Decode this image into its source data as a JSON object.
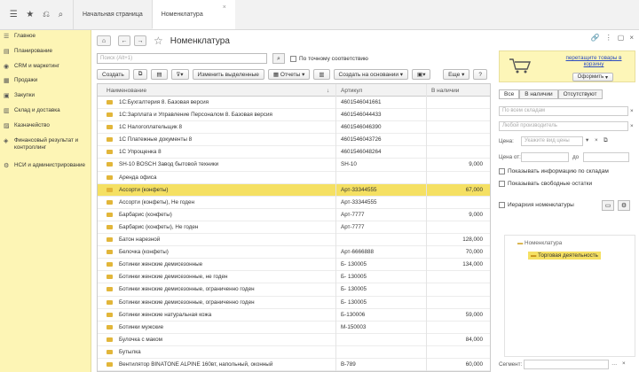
{
  "tabs": [
    {
      "label": "Начальная страница"
    },
    {
      "label": "Номенклатура"
    }
  ],
  "sidebar": {
    "items": [
      {
        "label": "Главное",
        "icon": "menu-icon"
      },
      {
        "label": "Планирование",
        "icon": "planning-icon"
      },
      {
        "label": "CRM и маркетинг",
        "icon": "crm-icon"
      },
      {
        "label": "Продажи",
        "icon": "sales-icon"
      },
      {
        "label": "Закупки",
        "icon": "purchases-icon"
      },
      {
        "label": "Склад и доставка",
        "icon": "warehouse-icon"
      },
      {
        "label": "Казначейство",
        "icon": "treasury-icon"
      },
      {
        "label": "Финансовый результат и контроллинг",
        "icon": "finance-icon"
      },
      {
        "label": "НСИ и администрирование",
        "icon": "gear-icon"
      }
    ]
  },
  "window": {
    "title": "Номенклатура",
    "search_placeholder": "Поиск (Alt+1)",
    "exact_match_label": "По точному соответствию"
  },
  "toolbar": {
    "create": "Создать",
    "change_selected": "Изменить выделенные",
    "reports": "Отчеты",
    "create_based": "Создать на основании",
    "more": "Еще"
  },
  "table": {
    "columns": [
      "Наименование",
      "Артикул",
      "В наличии"
    ],
    "rows": [
      {
        "name": "1С:Бухгалтерия 8. Базовая версия",
        "article": "4601546041661",
        "qty": ""
      },
      {
        "name": "1С:Зарплата и Управление Персоналом 8. Базовая версия",
        "article": "4601546044433",
        "qty": ""
      },
      {
        "name": "1С Налогоплательщик 8",
        "article": "4601546046390",
        "qty": ""
      },
      {
        "name": "1С Платежные документы 8",
        "article": "4601546043726",
        "qty": ""
      },
      {
        "name": "1С Упрощенка 8",
        "article": "4601546048264",
        "qty": ""
      },
      {
        "name": "SH-10 BOSCH Завод бытовой техники",
        "article": "SH-10",
        "qty": "9,000"
      },
      {
        "name": "Аренда офиса",
        "article": "",
        "qty": ""
      },
      {
        "name": "Ассорти (конфеты)",
        "article": "Арт-33344555",
        "qty": "67,000"
      },
      {
        "name": "Ассорти (конфеты), Не годен",
        "article": "Арт-33344555",
        "qty": ""
      },
      {
        "name": "Барбарис (конфеты)",
        "article": "Арт-7777",
        "qty": "9,000"
      },
      {
        "name": "Барбарис (конфеты), Не годен",
        "article": "Арт-7777",
        "qty": ""
      },
      {
        "name": "Батон нарезной",
        "article": "",
        "qty": "128,000"
      },
      {
        "name": "Белочка (конфеты)",
        "article": "Арт-6666888",
        "qty": "70,000"
      },
      {
        "name": "Ботинки женские демисезонные",
        "article": "Б- 130005",
        "qty": "134,000"
      },
      {
        "name": "Ботинки женские демисезонные, не годен",
        "article": "Б- 130005",
        "qty": ""
      },
      {
        "name": "Ботинки женские демисезонные, ограниченно годен",
        "article": "Б- 130005",
        "qty": ""
      },
      {
        "name": "Ботинки женские демисезонные, ограниченно годен",
        "article": "Б- 130005",
        "qty": ""
      },
      {
        "name": "Ботинки женские натуральная кожа",
        "article": "Б-130006",
        "qty": "59,000"
      },
      {
        "name": "Ботинки мужские",
        "article": "М-150003",
        "qty": ""
      },
      {
        "name": "Булочка с маком",
        "article": "",
        "qty": "84,000"
      },
      {
        "name": "Бутылка",
        "article": "",
        "qty": ""
      },
      {
        "name": "Вентилятор BINATONE ALPINE 160вт, напольный, оконный",
        "article": "В-789",
        "qty": "60,000"
      }
    ]
  },
  "panel": {
    "drag_text": "перетащите товары в корзину",
    "oform": "Оформить",
    "segments": [
      "Все",
      "В наличии",
      "Отсутствуют"
    ],
    "warehouses_placeholder": "По всем складам",
    "any_manufacturer_placeholder": "Любой производитель",
    "price_label": "Цена:",
    "price_type_placeholder": "Укажите вид цены",
    "price_from_label": "Цена от:",
    "to_label": "до",
    "show_warehouse_info": "Показывать информацию по складам",
    "show_free_stock": "Показывать свободные остатки",
    "hierarchy_label": "Иерархия номенклатуры",
    "tree_root": "Номенклатура",
    "tree_child": "Торговая деятельность",
    "segment_label": "Сегмент:"
  }
}
